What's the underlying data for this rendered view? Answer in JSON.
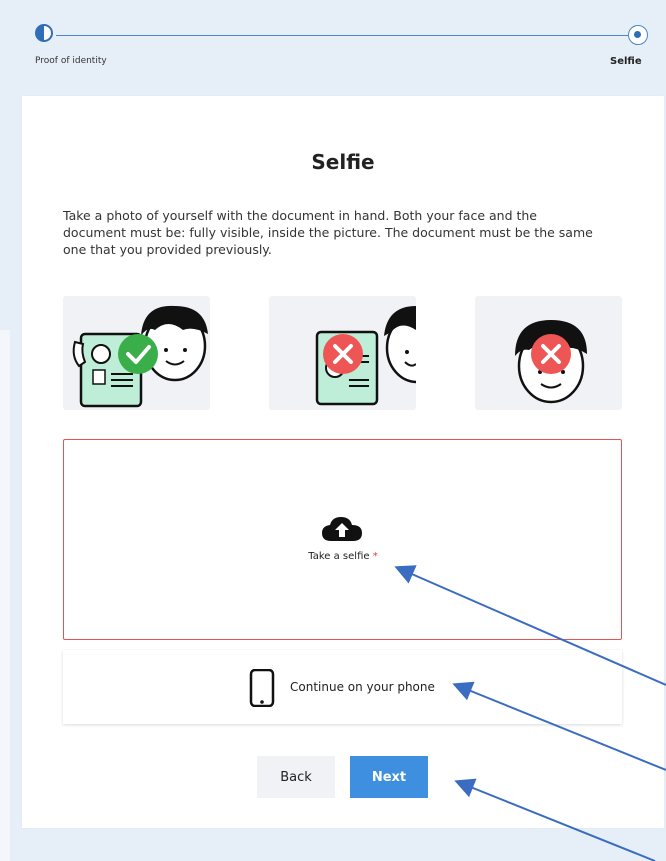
{
  "stepper": {
    "step1_label": "Proof of identity",
    "step2_label": "Selfie"
  },
  "page": {
    "title": "Selfie",
    "description": "Take a photo of yourself with the document in hand. Both your face and the document must be: fully visible, inside the picture. The document must be the same one that you provided previously."
  },
  "illustrations": [
    {
      "name": "selfie-correct-example",
      "status": "correct"
    },
    {
      "name": "selfie-cropped-example",
      "status": "incorrect"
    },
    {
      "name": "selfie-no-document-example",
      "status": "incorrect"
    }
  ],
  "upload": {
    "label": "Take a selfie",
    "required_mark": "*",
    "icon": "cloud-upload-icon"
  },
  "phone": {
    "label": "Continue on your phone",
    "icon": "smartphone-icon"
  },
  "buttons": {
    "back": "Back",
    "next": "Next"
  },
  "colors": {
    "accent": "#3f8fe0",
    "step": "#2f6fb7",
    "error": "#e35555",
    "success": "#3aae49"
  }
}
